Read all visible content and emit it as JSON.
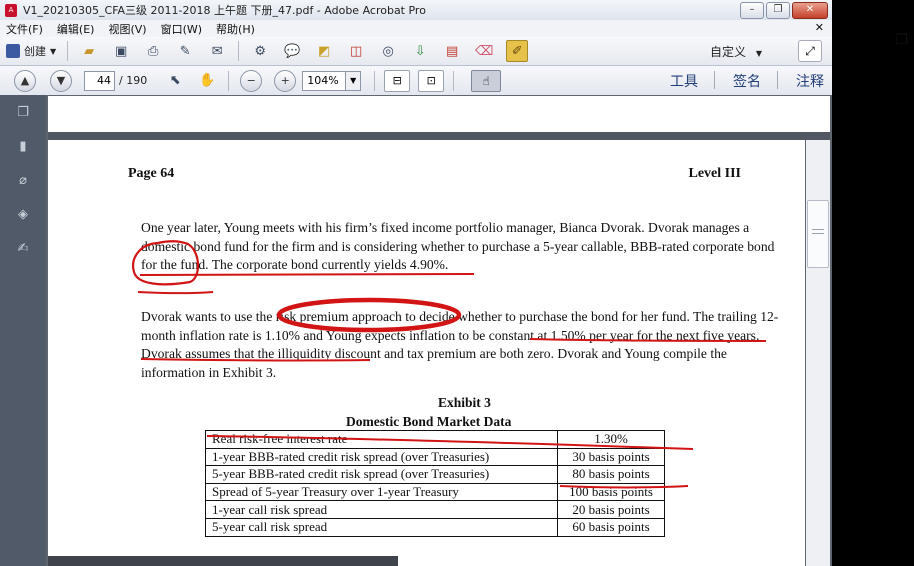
{
  "window": {
    "title": "V1_20210305_CFA三级 2011-2018 上午题 下册_47.pdf - Adobe Acrobat Pro"
  },
  "menu": [
    "文件(F)",
    "编辑(E)",
    "视图(V)",
    "窗口(W)",
    "帮助(H)"
  ],
  "toolbar": {
    "create_label": "创建",
    "custom_label": "自定义"
  },
  "nav": {
    "page_current": "44",
    "page_total": "/ 190",
    "zoom": "104%"
  },
  "panes": {
    "tools": "工具",
    "sign": "签名",
    "comment": "注释"
  },
  "page": {
    "header_left": "Page 64",
    "header_right": "Level III",
    "para1": "One year later, Young meets with his firm’s fixed income portfolio manager, Bianca Dvorak. Dvorak manages a domestic bond fund for the firm and is considering whether to purchase a 5-year callable, BBB-rated corporate bond for the fund.  The corporate bond currently yields 4.90%.",
    "para2": "Dvorak wants to use the risk premium approach to decide whether to purchase the bond for her fund.  The trailing 12-month inflation rate is 1.10% and Young expects inflation to be constant at 1.50% per year for the next five years.  Dvorak assumes that the illiquidity discount and tax premium are both zero.  Dvorak and Young compile the information in Exhibit 3.",
    "exhibit_number": "Exhibit 3",
    "exhibit_title": "Domestic Bond Market Data",
    "table": [
      {
        "label": "Real risk-free interest rate",
        "value": "1.30%"
      },
      {
        "label": "1-year BBB-rated credit risk spread (over Treasuries)",
        "value": "30 basis points"
      },
      {
        "label": "5-year BBB-rated credit risk spread (over Treasuries)",
        "value": "80 basis points"
      },
      {
        "label": "Spread of 5-year Treasury over 1-year Treasury",
        "value": "100 basis points"
      },
      {
        "label": "1-year call risk spread",
        "value": "20 basis points"
      },
      {
        "label": "5-year call risk spread",
        "value": "60 basis points"
      }
    ]
  },
  "colors": {
    "annotation": "#d21414",
    "rail": "#505a68",
    "accent_text": "#243e78"
  }
}
